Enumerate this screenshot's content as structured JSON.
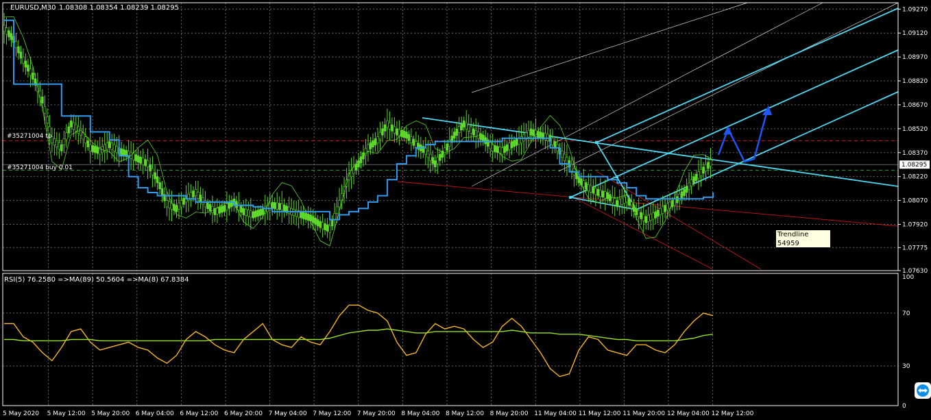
{
  "chart_data": [
    {
      "type": "candlestick",
      "title": "EURUSD,M30",
      "header_values": "1.08308 1.08354 1.08239 1.08295",
      "ylim": [
        1.0763,
        1.0931
      ],
      "y_ticks": [
        "1.09270",
        "1.09120",
        "1.08970",
        "1.08820",
        "1.08670",
        "1.08520",
        "1.08370",
        "1.08220",
        "1.08070",
        "1.07920",
        "1.07775",
        "1.07630"
      ],
      "y_tick_values": [
        1.0927,
        1.0912,
        1.0897,
        1.0882,
        1.0867,
        1.0852,
        1.0837,
        1.0822,
        1.0807,
        1.0792,
        1.07775,
        1.0763
      ],
      "x_ticks": [
        "5 May 2020",
        "5 May 12:00",
        "5 May 20:00",
        "6 May 04:00",
        "6 May 12:00",
        "6 May 20:00",
        "7 May 04:00",
        "7 May 12:00",
        "7 May 20:00",
        "8 May 04:00",
        "8 May 12:00",
        "8 May 20:00",
        "11 May 04:00",
        "11 May 12:00",
        "11 May 20:00",
        "12 May 04:00",
        "12 May 12:00"
      ],
      "current_price": "1.08295",
      "current_price_value": 1.08295,
      "order_labels": [
        "#35271004 tp",
        "#35271004 buy 0.01"
      ],
      "order_levels": [
        1.08445,
        1.0826
      ],
      "grid": true,
      "close_series": [
        1.0915,
        1.0908,
        1.0895,
        1.0885,
        1.087,
        1.0845,
        1.084,
        1.0855,
        1.085,
        1.084,
        1.0838,
        1.0842,
        1.0838,
        1.0836,
        1.0833,
        1.083,
        1.082,
        1.0805,
        1.0802,
        1.0808,
        1.0812,
        1.0805,
        1.08,
        1.0802,
        1.0806,
        1.08,
        1.0798,
        1.08,
        1.0804,
        1.0803,
        1.08,
        1.0798,
        1.0796,
        1.0792,
        1.0789,
        1.0805,
        1.0822,
        1.083,
        1.084,
        1.0845,
        1.0855,
        1.085,
        1.0848,
        1.0842,
        1.0838,
        1.083,
        1.0838,
        1.0848,
        1.0855,
        1.085,
        1.0846,
        1.084,
        1.0838,
        1.0842,
        1.0845,
        1.085,
        1.0848,
        1.0846,
        1.0838,
        1.083,
        1.082,
        1.0815,
        1.0812,
        1.081,
        1.0805,
        1.0808,
        1.08,
        1.0795,
        1.0798,
        1.0802,
        1.0806,
        1.0812,
        1.082,
        1.0826,
        1.0832
      ],
      "ma_series": [
        1.092,
        1.088,
        1.088,
        1.088,
        1.088,
        1.088,
        1.086,
        1.086,
        1.086,
        1.085,
        1.085,
        1.0845,
        1.0835,
        1.0822,
        1.0815,
        1.0812,
        1.081,
        1.081,
        1.081,
        1.0808,
        1.0806,
        1.0806,
        1.0806,
        1.0806,
        1.0804,
        1.0804,
        1.0803,
        1.0802,
        1.08,
        1.08,
        1.08,
        1.08,
        1.08,
        1.08,
        1.0795,
        1.0798,
        1.08,
        1.0802,
        1.0806,
        1.081,
        1.082,
        1.083,
        1.0835,
        1.084,
        1.0842,
        1.0844,
        1.0844,
        1.0844,
        1.0844,
        1.0844,
        1.0844,
        1.0844,
        1.0846,
        1.0846,
        1.0846,
        1.0846,
        1.0846,
        1.084,
        1.083,
        1.0825,
        1.0822,
        1.0822,
        1.0822,
        1.082,
        1.0818,
        1.0815,
        1.081,
        1.0808,
        1.0808,
        1.0808,
        1.0808,
        1.0808,
        1.0808,
        1.0809,
        1.0812
      ],
      "annotation": {
        "name": "Trendline 54959",
        "value": "1.07964"
      }
    },
    {
      "type": "line",
      "title": "RSI(5) 76.2580  =>MA(89) 50.5604  =>MA(8) 67.8384",
      "ylim": [
        0,
        100
      ],
      "y_ticks": [
        "100",
        "70",
        "30",
        "0"
      ],
      "y_tick_values": [
        100,
        70,
        30,
        0
      ],
      "series": [
        {
          "name": "RSI(5)",
          "color": "#f7b728",
          "values": [
            62,
            62,
            52,
            48,
            40,
            34,
            44,
            56,
            58,
            48,
            42,
            44,
            46,
            48,
            44,
            42,
            36,
            32,
            38,
            50,
            56,
            52,
            46,
            42,
            40,
            50,
            56,
            62,
            50,
            46,
            44,
            52,
            48,
            46,
            56,
            68,
            76,
            76,
            72,
            70,
            64,
            48,
            38,
            40,
            54,
            62,
            58,
            60,
            58,
            50,
            44,
            48,
            60,
            66,
            60,
            50,
            40,
            28,
            22,
            24,
            42,
            52,
            50,
            42,
            40,
            38,
            46,
            46,
            42,
            40,
            46,
            56,
            64,
            70,
            68
          ]
        },
        {
          "name": "MA",
          "color": "#9ae027",
          "values": [
            50,
            50,
            49,
            49,
            49,
            49,
            49,
            50,
            50,
            50,
            49,
            49,
            49,
            49,
            49,
            49,
            49,
            49,
            49,
            49,
            49,
            49,
            50,
            50,
            50,
            50,
            50,
            50,
            50,
            50,
            50,
            50,
            50,
            50,
            51,
            53,
            55,
            56,
            57,
            57,
            58,
            57,
            56,
            55,
            55,
            56,
            56,
            56,
            56,
            56,
            56,
            56,
            56,
            57,
            56,
            55,
            55,
            55,
            54,
            54,
            54,
            53,
            52,
            51,
            50,
            50,
            49,
            49,
            49,
            49,
            49,
            50,
            51,
            53,
            54
          ]
        }
      ]
    }
  ]
}
